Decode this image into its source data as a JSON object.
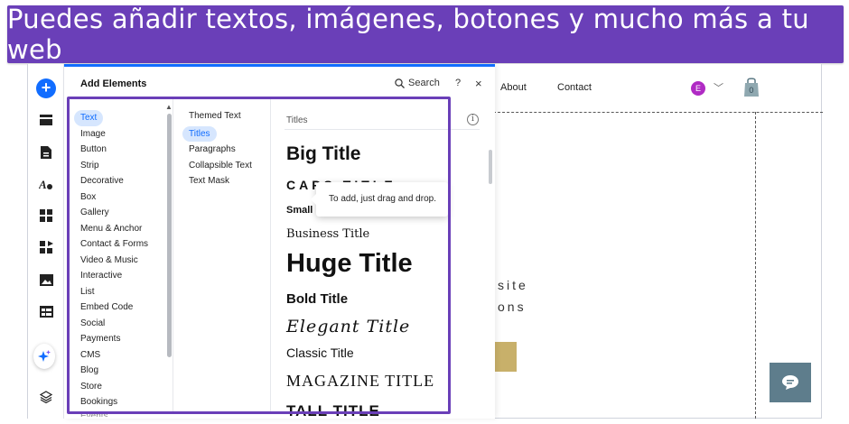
{
  "banner": {
    "text": "Puedes añadir textos, imágenes, botones y mucho más a tu web"
  },
  "panel": {
    "title": "Add Elements",
    "search_label": "Search",
    "help_label": "?",
    "close_label": "×",
    "categories": [
      "Text",
      "Image",
      "Button",
      "Strip",
      "Decorative",
      "Box",
      "Gallery",
      "Menu & Anchor",
      "Contact & Forms",
      "Video & Music",
      "Interactive",
      "List",
      "Embed Code",
      "Social",
      "Payments",
      "CMS",
      "Blog",
      "Store",
      "Bookings",
      "Events"
    ],
    "active_category": "Text",
    "subcategories": [
      "Themed Text",
      "Titles",
      "Paragraphs",
      "Collapsible Text",
      "Text Mask"
    ],
    "active_subcategory": "Titles",
    "section_label": "Titles",
    "titles": [
      "Big Title",
      "CAPS TITLE",
      "Small",
      "Business Title",
      "Huge Title",
      "Bold Title",
      "Elegant Title",
      "Classic Title",
      "MAGAZINE TITLE",
      "TALL TITLE"
    ],
    "tooltip": "To add, just drag and drop."
  },
  "site": {
    "nav_about": "About",
    "nav_contact": "Contact",
    "avatar_letter": "E",
    "text_line1": "site",
    "text_line2": "ons"
  },
  "colors": {
    "banner": "#6a3fb8",
    "accent": "#116dff",
    "highlight": "#6a3fb8"
  }
}
